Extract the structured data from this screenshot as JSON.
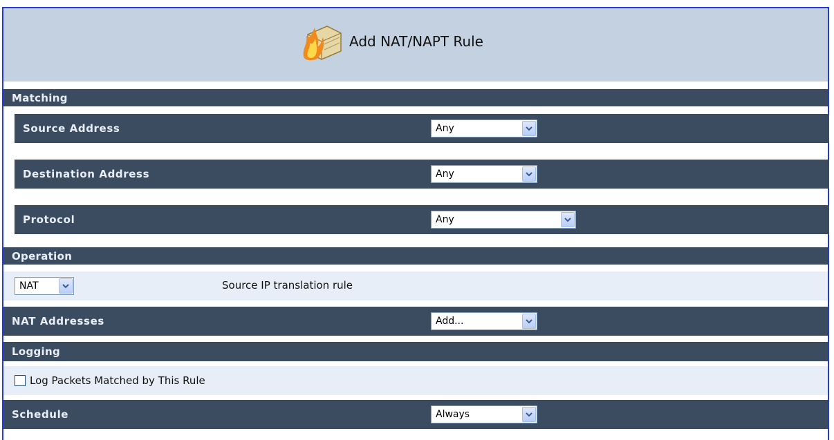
{
  "header": {
    "title": "Add NAT/NAPT Rule",
    "icon": "firewall-icon"
  },
  "sections": {
    "matching": "Matching",
    "operation": "Operation",
    "logging": "Logging"
  },
  "matching": {
    "source_label": "Source Address",
    "source_value": "Any",
    "destination_label": "Destination Address",
    "destination_value": "Any",
    "protocol_label": "Protocol",
    "protocol_value": "Any"
  },
  "operation": {
    "type_value": "NAT",
    "description": "Source IP translation rule"
  },
  "nat_addresses": {
    "label": "NAT Addresses",
    "value": "Add..."
  },
  "logging": {
    "checkbox_label": "Log Packets Matched by This Rule",
    "checked": false
  },
  "schedule": {
    "label": "Schedule",
    "value": "Always"
  },
  "colors": {
    "header_band": "#c3d1e1",
    "dark_row": "#3c4c60",
    "light_row": "#e8eef7",
    "frame": "#243bd6"
  }
}
